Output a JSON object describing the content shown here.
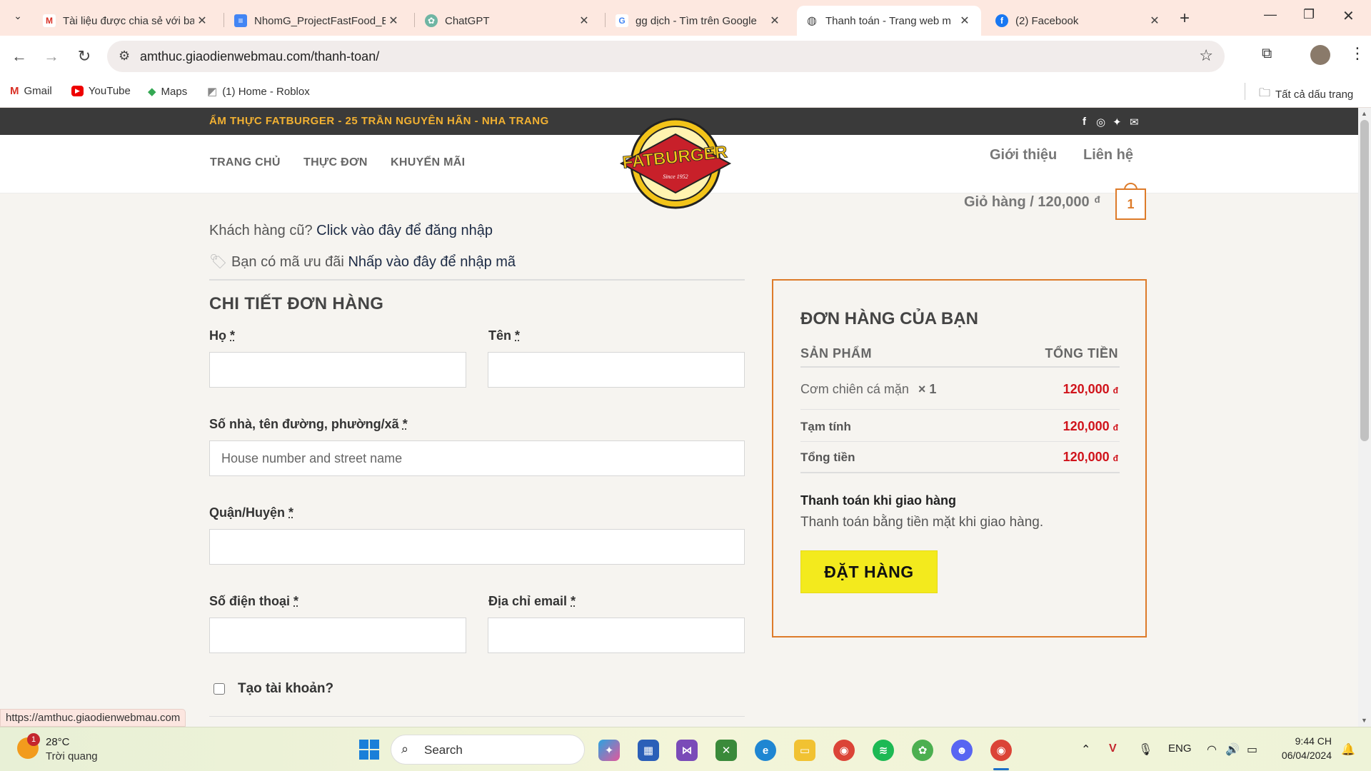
{
  "browser": {
    "tabs": [
      {
        "title": "Tài liệu được chia sẻ với ba",
        "icon": "gmail-icon"
      },
      {
        "title": "NhomG_ProjectFastFood_B",
        "icon": "docs-icon"
      },
      {
        "title": "ChatGPT",
        "icon": "chatgpt-icon"
      },
      {
        "title": "gg dịch - Tìm trên Google",
        "icon": "google-icon"
      },
      {
        "title": "Thanh toán - Trang web m",
        "icon": "globe-icon",
        "active": true
      },
      {
        "title": "(2) Facebook",
        "icon": "facebook-icon"
      }
    ],
    "url": "amthuc.giaodienwebmau.com/thanh-toan/",
    "bookmarks": [
      "Gmail",
      "YouTube",
      "Maps",
      "(1) Home - Roblox"
    ],
    "all_bookmarks": "Tất cả dấu trang",
    "status_url": "https://amthuc.giaodienwebmau.com"
  },
  "site": {
    "topbar": "ẨM THỰC FATBURGER - 25 TRẦN NGUYÊN HÃN - NHA TRANG",
    "social": [
      "f",
      "ig",
      "tw",
      "mail"
    ],
    "nav_left": [
      "TRANG CHỦ",
      "THỰC ĐƠN",
      "KHUYẾN MÃI"
    ],
    "nav_right": [
      "Giới thiệu",
      "Liên hệ"
    ],
    "logo": {
      "name": "FATBURGER",
      "since": "Since 1952"
    },
    "cart": {
      "label": "Giỏ hàng / 120,000",
      "currency": "đ",
      "count": "1"
    }
  },
  "checkout": {
    "returning": {
      "prefix": "Khách hàng cũ?",
      "link": "Click vào đây để đăng nhập"
    },
    "coupon": {
      "prefix": "Bạn có mã ưu đãi",
      "link": "Nhấp vào đây để nhập mã"
    },
    "section_title": "CHI TIẾT ĐƠN HÀNG",
    "required_mark": "*",
    "fields": {
      "last_name": {
        "label": "Họ",
        "value": ""
      },
      "first_name": {
        "label": "Tên",
        "value": ""
      },
      "address": {
        "label": "Số nhà, tên đường, phường/xã",
        "placeholder": "House number and street name"
      },
      "district": {
        "label": "Quận/Huyện",
        "value": ""
      },
      "phone": {
        "label": "Số điện thoại",
        "value": ""
      },
      "email": {
        "label": "Địa chỉ email",
        "value": ""
      }
    },
    "create_account": "Tạo tài khoản?"
  },
  "order": {
    "title": "ĐƠN HÀNG CỦA BẠN",
    "col_product": "SẢN PHẨM",
    "col_total": "TỔNG TIỀN",
    "item": {
      "name": "Cơm chiên cá mặn",
      "qty": "× 1",
      "price": "120,000"
    },
    "subtotal": {
      "label": "Tạm tính",
      "value": "120,000"
    },
    "total": {
      "label": "Tổng tiền",
      "value": "120,000"
    },
    "currency": "đ",
    "payment_title": "Thanh toán khi giao hàng",
    "payment_desc": "Thanh toán bằng tiền mặt khi giao hàng.",
    "button": "ĐẶT HÀNG"
  },
  "taskbar": {
    "weather": {
      "temp": "28°C",
      "desc": "Trời quang",
      "badge": "1"
    },
    "search": "Search",
    "lang": "ENG",
    "time": "9:44 CH",
    "date": "06/04/2024"
  },
  "colors": {
    "accent": "#dd7b2a",
    "price": "#d0131b",
    "button": "#f3ea1d",
    "topbar": "#3a3a3a",
    "topbar_text": "#f2b132"
  }
}
